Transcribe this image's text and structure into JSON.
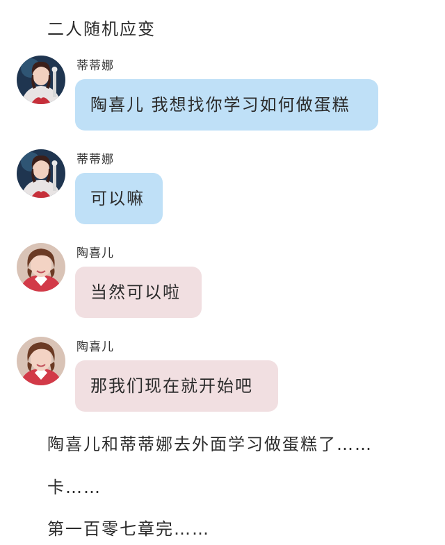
{
  "title": "二人随机应变",
  "messages": [
    {
      "sender": "蒂蒂娜",
      "text": "陶喜儿 我想找你学习如何做蛋糕",
      "avatar": "tina-avatar",
      "bubble_color": "#bfe0f7"
    },
    {
      "sender": "蒂蒂娜",
      "text": "可以嘛",
      "avatar": "tina-avatar",
      "bubble_color": "#bfe0f7"
    },
    {
      "sender": "陶喜儿",
      "text": "当然可以啦",
      "avatar": "taoxier-avatar",
      "bubble_color": "#f1dfe1"
    },
    {
      "sender": "陶喜儿",
      "text": "那我们现在就开始吧",
      "avatar": "taoxier-avatar",
      "bubble_color": "#f1dfe1"
    }
  ],
  "narration": [
    "陶喜儿和蒂蒂娜去外面学习做蛋糕了……",
    "卡……",
    "第一百零七章完……"
  ]
}
